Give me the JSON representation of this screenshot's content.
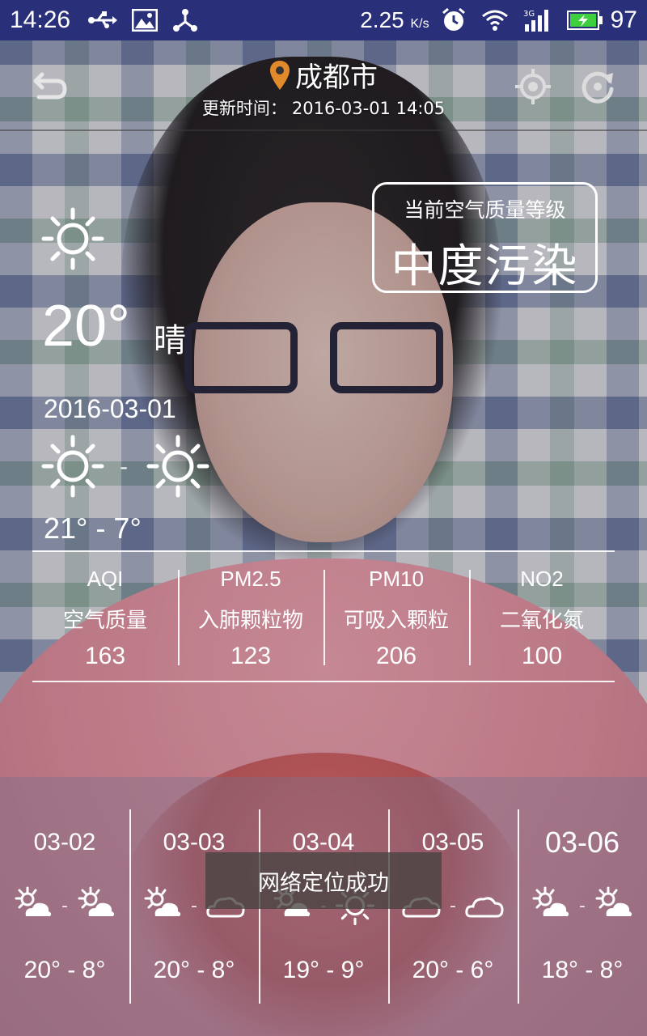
{
  "status_bar": {
    "time": "14:26",
    "speed": "2.25",
    "speed_unit": "K/s",
    "battery": "97",
    "icons": [
      "usb-icon",
      "image-icon",
      "share-icon",
      "alarm-icon",
      "wifi-icon",
      "signal-3g-icon",
      "battery-icon"
    ]
  },
  "header": {
    "city": "成都市",
    "update_label": "更新时间：",
    "update_time": "2016-03-01 14:05",
    "icons": [
      "back-icon",
      "locate-icon",
      "refresh-icon"
    ]
  },
  "air_quality": {
    "title": "当前空气质量等级",
    "level": "中度污染"
  },
  "current": {
    "temp": "20°",
    "desc": "晴",
    "icon": "sun-icon"
  },
  "today": {
    "date": "2016-03-01",
    "dash": "-",
    "range": "21° - 7°",
    "icons": [
      "sun-icon",
      "sun-icon"
    ]
  },
  "aqi": [
    {
      "code": "AQI",
      "name": "空气质量",
      "value": "163"
    },
    {
      "code": "PM2.5",
      "name": "入肺颗粒物",
      "value": "123"
    },
    {
      "code": "PM10",
      "name": "可吸入颗粒",
      "value": "206"
    },
    {
      "code": "NO2",
      "name": "二氧化氮",
      "value": "100"
    }
  ],
  "forecast": [
    {
      "date": "03-02",
      "day_icon": "partly-sunny-icon",
      "night_icon": "partly-sunny-icon",
      "dash": "-",
      "range": "20° - 8°"
    },
    {
      "date": "03-03",
      "day_icon": "partly-sunny-icon",
      "night_icon": "cloud-icon",
      "dash": "-",
      "range": "20° - 8°"
    },
    {
      "date": "03-04",
      "day_icon": "partly-sunny-icon",
      "night_icon": "sun-icon",
      "dash": "-",
      "range": "19° - 9°"
    },
    {
      "date": "03-05",
      "day_icon": "cloud-icon",
      "night_icon": "cloud-icon",
      "dash": "-",
      "range": "20° - 6°"
    },
    {
      "date": "03-06",
      "day_icon": "partly-sunny-icon",
      "night_icon": "partly-sunny-icon",
      "dash": "-",
      "range": "18° - 8°"
    }
  ],
  "toast": {
    "message": "网络定位成功"
  }
}
